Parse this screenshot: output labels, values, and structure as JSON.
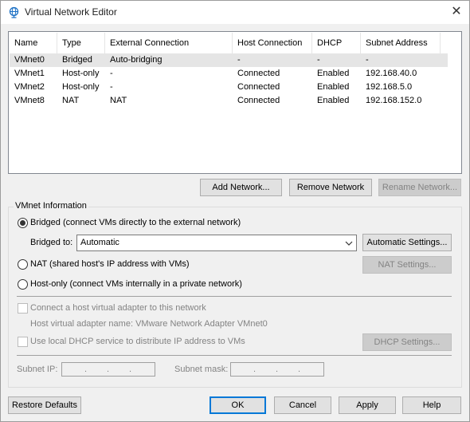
{
  "window": {
    "title": "Virtual Network Editor",
    "icon": "network-globe-icon",
    "close_glyph": "✕"
  },
  "table": {
    "columns": [
      "Name",
      "Type",
      "External Connection",
      "Host Connection",
      "DHCP",
      "Subnet Address"
    ],
    "rows": [
      [
        "VMnet0",
        "Bridged",
        "Auto-bridging",
        "-",
        "-",
        "-"
      ],
      [
        "VMnet1",
        "Host-only",
        "-",
        "Connected",
        "Enabled",
        "192.168.40.0"
      ],
      [
        "VMnet2",
        "Host-only",
        "-",
        "Connected",
        "Enabled",
        "192.168.5.0"
      ],
      [
        "VMnet8",
        "NAT",
        "NAT",
        "Connected",
        "Enabled",
        "192.168.152.0"
      ]
    ],
    "selected_row": 0
  },
  "list_buttons": {
    "add": "Add Network...",
    "remove": "Remove Network",
    "rename": "Rename Network..."
  },
  "vmnet_info": {
    "legend": "VMnet Information",
    "bridged_label": "Bridged (connect VMs directly to the external network)",
    "bridged_to_label": "Bridged to:",
    "bridged_to_value": "Automatic",
    "auto_settings": "Automatic Settings...",
    "nat_label": "NAT (shared host's IP address with VMs)",
    "nat_settings": "NAT Settings...",
    "hostonly_label": "Host-only (connect VMs internally in a private network)",
    "selected_mode": "bridged",
    "connect_adapter_label": "Connect a host virtual adapter to this network",
    "adapter_name_label": "Host virtual adapter name: VMware Network Adapter VMnet0",
    "dhcp_label": "Use local DHCP service to distribute IP address to VMs",
    "dhcp_settings": "DHCP Settings...",
    "subnet_ip_label": "Subnet IP:",
    "subnet_mask_label": "Subnet mask:",
    "ip_dot": "."
  },
  "footer": {
    "restore": "Restore Defaults",
    "ok": "OK",
    "cancel": "Cancel",
    "apply": "Apply",
    "help": "Help"
  }
}
